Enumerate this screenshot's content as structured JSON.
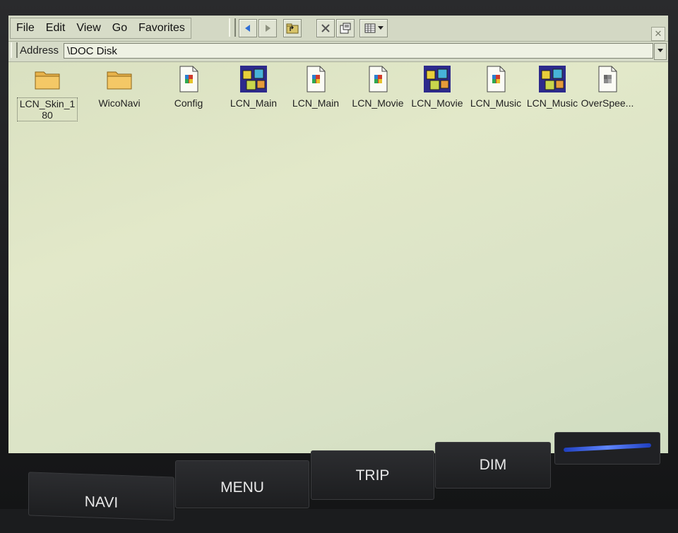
{
  "menu": {
    "items": [
      "File",
      "Edit",
      "View",
      "Go",
      "Favorites"
    ]
  },
  "address": {
    "label": "Address",
    "value": "\\DOC Disk"
  },
  "files": [
    {
      "name": "LCN_Skin_180",
      "icon": "folder-icon",
      "selected": true
    },
    {
      "name": "WicoNavi",
      "icon": "folder-icon",
      "selected": false
    },
    {
      "name": "Config",
      "icon": "executable-file-icon",
      "selected": false
    },
    {
      "name": "LCN_Main",
      "icon": "dll-cubes-icon",
      "selected": false
    },
    {
      "name": "LCN_Main",
      "icon": "executable-file-icon",
      "selected": false
    },
    {
      "name": "LCN_Movie",
      "icon": "executable-file-icon",
      "selected": false
    },
    {
      "name": "LCN_Movie",
      "icon": "dll-cubes-icon",
      "selected": false
    },
    {
      "name": "LCN_Music",
      "icon": "executable-file-icon",
      "selected": false
    },
    {
      "name": "LCN_Music",
      "icon": "dll-cubes-icon",
      "selected": false
    },
    {
      "name": "OverSpee...",
      "icon": "executable-file-icon",
      "selected": false
    }
  ],
  "hardware_buttons": {
    "navi": "NAVI",
    "menu": "MENU",
    "trip": "TRIP",
    "dim": "DIM"
  }
}
